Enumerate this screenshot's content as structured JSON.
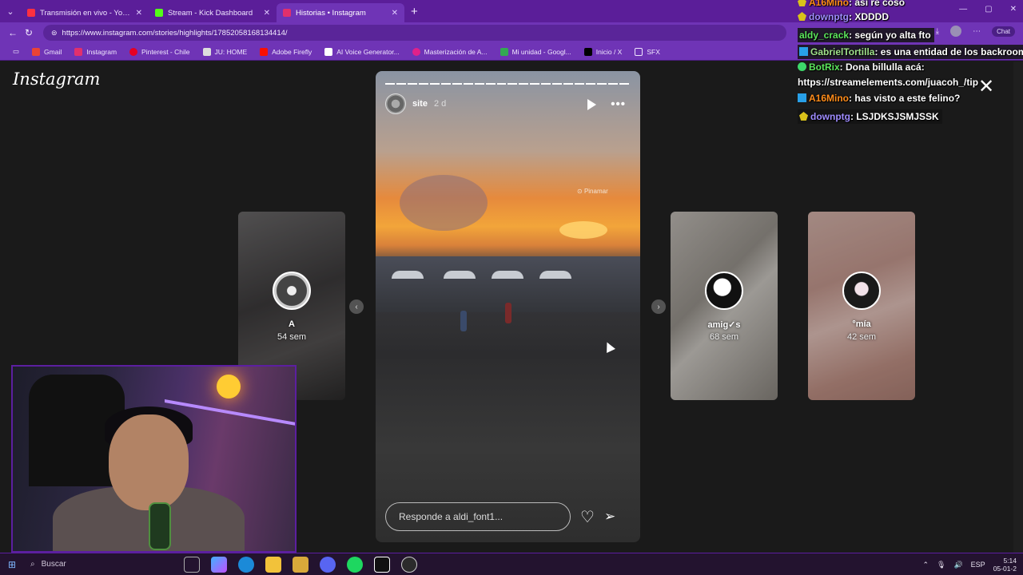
{
  "tabs": [
    {
      "title": "Transmisión en vivo - YouTube Stu",
      "favicon_color": "#ff3040",
      "active": false
    },
    {
      "title": "Stream - Kick Dashboard",
      "favicon_color": "#53fc18",
      "active": false
    },
    {
      "title": "Historias • Instagram",
      "favicon_color": "#e1306c",
      "active": true
    }
  ],
  "address": {
    "url": "https://www.instagram.com/stories/highlights/17852058168134414/"
  },
  "bookmarks": [
    {
      "label": "Gmail",
      "icon": "gmail-icon",
      "color": "#ea4335"
    },
    {
      "label": "Instagram",
      "icon": "instagram-icon",
      "color": "#e1306c"
    },
    {
      "label": "Pinterest - Chile",
      "icon": "pinterest-icon",
      "color": "#e60023"
    },
    {
      "label": "JU: HOME",
      "icon": "home-icon",
      "color": "#dddddd"
    },
    {
      "label": "Adobe Firefly",
      "icon": "adobe-icon",
      "color": "#fa0f00"
    },
    {
      "label": "AI Voice Generator...",
      "icon": "ai-voice-icon",
      "color": "#ffffff"
    },
    {
      "label": "Masterización de A...",
      "icon": "mastering-icon",
      "color": "#e0218a"
    },
    {
      "label": "Mi unidad - Googl...",
      "icon": "drive-icon",
      "color": "#34a853"
    },
    {
      "label": "Inicio / X",
      "icon": "x-icon",
      "color": "#000000"
    },
    {
      "label": "SFX",
      "icon": "folder-icon",
      "color": "#f0e6ff"
    }
  ],
  "header": {
    "logo": "Instagram",
    "close": "✕"
  },
  "story": {
    "username": "site",
    "time": "2 d",
    "location": "Pinamar",
    "reply_placeholder": "Responde a aldi_font1...",
    "progress_total": 22,
    "progress_done": 22
  },
  "side_stories": [
    {
      "name": "A",
      "time": "54 sem"
    },
    {
      "name": "amig✓s",
      "time": "68 sem"
    },
    {
      "name": "°mía",
      "time": "42 sem"
    }
  ],
  "chat": [
    {
      "user": "A16Mino",
      "user_color": "#ff8c1a",
      "badge": "sub",
      "message": ": así re coso"
    },
    {
      "user": "downptg",
      "user_color": "#9f8cff",
      "badge": "sub",
      "message": ": XDDDD"
    },
    {
      "user": "aldy_crack",
      "user_color": "#5ce65c",
      "badge": "",
      "message": ": según yo alta fto"
    },
    {
      "user": "GabrielTortilla",
      "user_color": "#9fe08a",
      "badge": "mod",
      "message": ": es una entidad de los backrooms"
    },
    {
      "user": "BotRix",
      "user_color": "#5ce65c",
      "badge": "ver",
      "message": ": Dona billulla acá:"
    },
    {
      "user": "",
      "user_color": "#ffffff",
      "badge": "",
      "message": "https://streamelements.com/juacoh_/tip"
    },
    {
      "user": "A16Mino",
      "user_color": "#ff8c1a",
      "badge": "mod",
      "message": ": has visto a este felino?"
    },
    {
      "user": "downptg",
      "user_color": "#9f8cff",
      "badge": "sub",
      "message": ": LSJDKSJSMJSSK"
    }
  ],
  "browser_extras": {
    "chat_label": "Chat"
  },
  "taskbar": {
    "search_placeholder": "Buscar",
    "lang": "ESP",
    "time": "5:14",
    "date": "05-01-2"
  }
}
